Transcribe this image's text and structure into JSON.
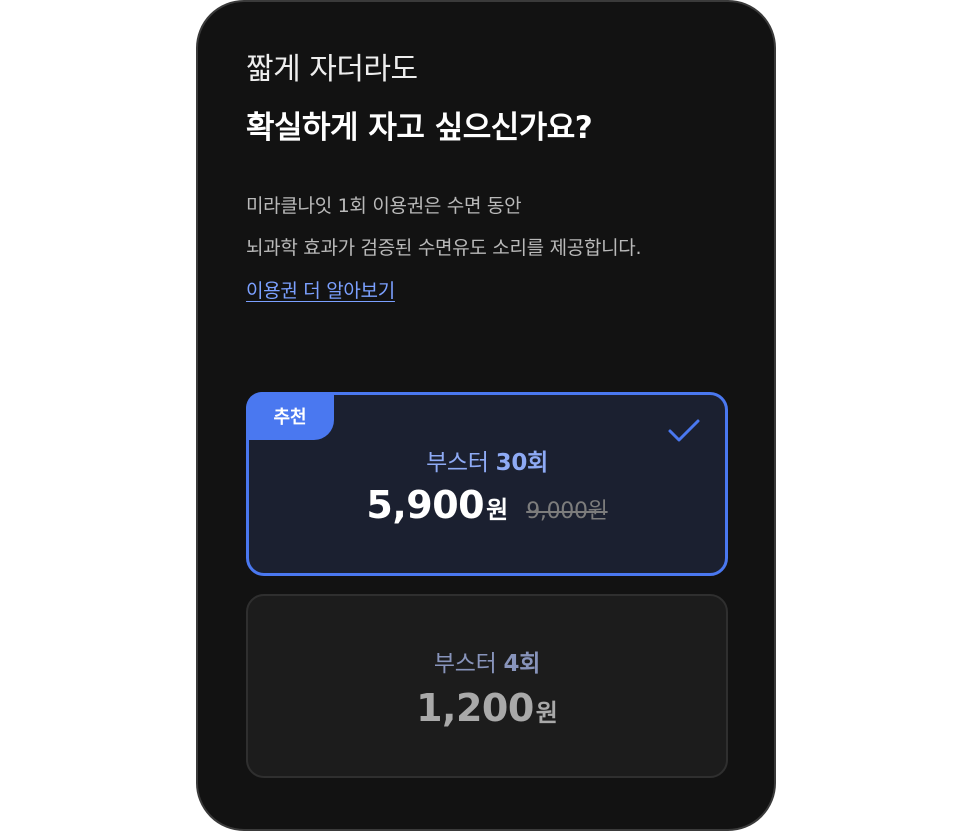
{
  "intro": {
    "subtitle": "짧게 자더라도",
    "title": "확실하게 자고 싶으신가요?",
    "description_lines": [
      "미라클나잇 1회 이용권은 수면 동안",
      "뇌과학 효과가 검증된 수면유도 소리를 제공합니다."
    ],
    "learn_more_link": "이용권 더 알아보기"
  },
  "plans": [
    {
      "badge": "추천",
      "name_prefix": "부스터 ",
      "name_count": "30회",
      "price": "5,900",
      "price_unit": "원",
      "original_price": "9,000원",
      "selected": true
    },
    {
      "name_prefix": "부스터 ",
      "name_count": "4회",
      "price": "1,200",
      "price_unit": "원",
      "selected": false
    }
  ],
  "colors": {
    "accent": "#4a78f0",
    "background": "#121212",
    "link": "#7ba0ff"
  },
  "icons": {
    "selected_indicator": "checkmark-icon"
  }
}
